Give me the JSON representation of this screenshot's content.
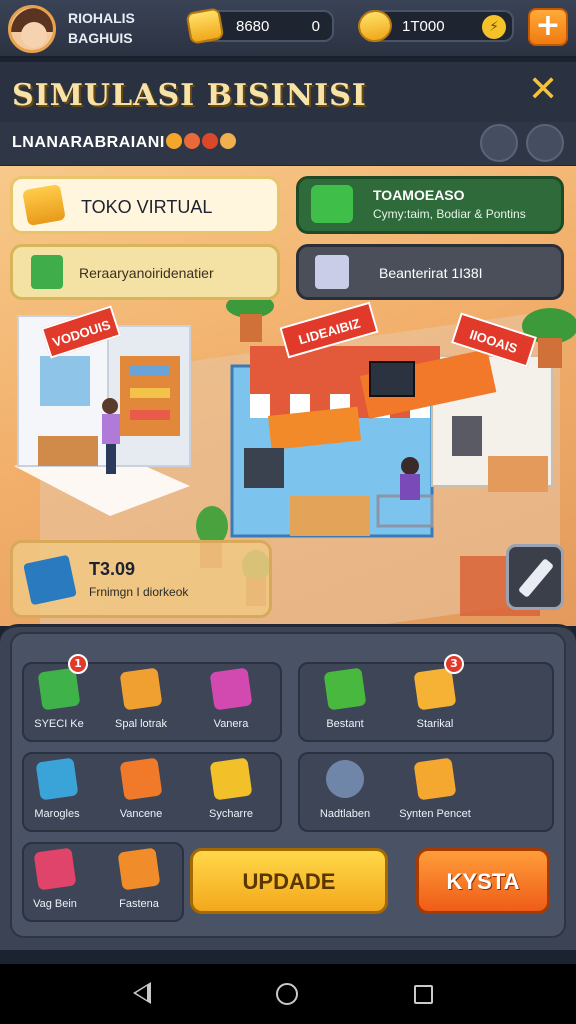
{
  "header": {
    "player_name_line1": "RIOHALIS",
    "player_name_line2": "BAGHUIS",
    "currency1_value": "8680",
    "currency1_extra": "0",
    "currency2_value": "1T000",
    "plus_label": "+"
  },
  "title": {
    "text": "SIMULASI BISINISI",
    "close_label": "✕",
    "subtitle": "LNANARABRAIANI"
  },
  "scene": {
    "cards": [
      {
        "label": "TOKO VIRTUAL"
      },
      {
        "title": "TOAMOEASO",
        "desc": "Cymy:taim, Bodiar & Pontins"
      },
      {
        "label": "Reraaryanoiridenatier"
      },
      {
        "label": "Beanterirat 1I38I"
      }
    ],
    "store_signs": {
      "left": "VODOUIS",
      "center": "LIDEAIBIZ",
      "right": "IIOOAIS"
    },
    "info_box": {
      "value": "T3.09",
      "desc": "Frnimgn I diorkeok"
    }
  },
  "panel": {
    "group1": [
      {
        "name": "SYECI Ke",
        "badge": "1",
        "color": "#3fb34a"
      },
      {
        "name": "Spal lotrak",
        "color": "#f0a030"
      },
      {
        "name": "Vanera",
        "color": "#d24ab0"
      }
    ],
    "group2": [
      {
        "name": "Bestant",
        "color": "#48b83e"
      },
      {
        "name": "Starikal",
        "badge": "3",
        "color": "#f5b234"
      }
    ],
    "group3": [
      {
        "name": "Marogles",
        "color": "#3aa3d8"
      },
      {
        "name": "Vancene",
        "color": "#f07a2a"
      },
      {
        "name": "Sycharre",
        "color": "#f2c12a"
      }
    ],
    "group4": [
      {
        "name": "Nadtlaben",
        "color": "#6f86a8"
      },
      {
        "name": "Synten Pencet",
        "color": "#f4a830"
      }
    ],
    "group5": [
      {
        "name": "Vag Bein",
        "color": "#e0446a"
      },
      {
        "name": "Fastena",
        "color": "#f08c2a"
      }
    ],
    "update_label": "UPDADE",
    "kysta_label": "KYSTA"
  },
  "navbar": {
    "back": "back",
    "home": "home",
    "recent": "recent"
  }
}
